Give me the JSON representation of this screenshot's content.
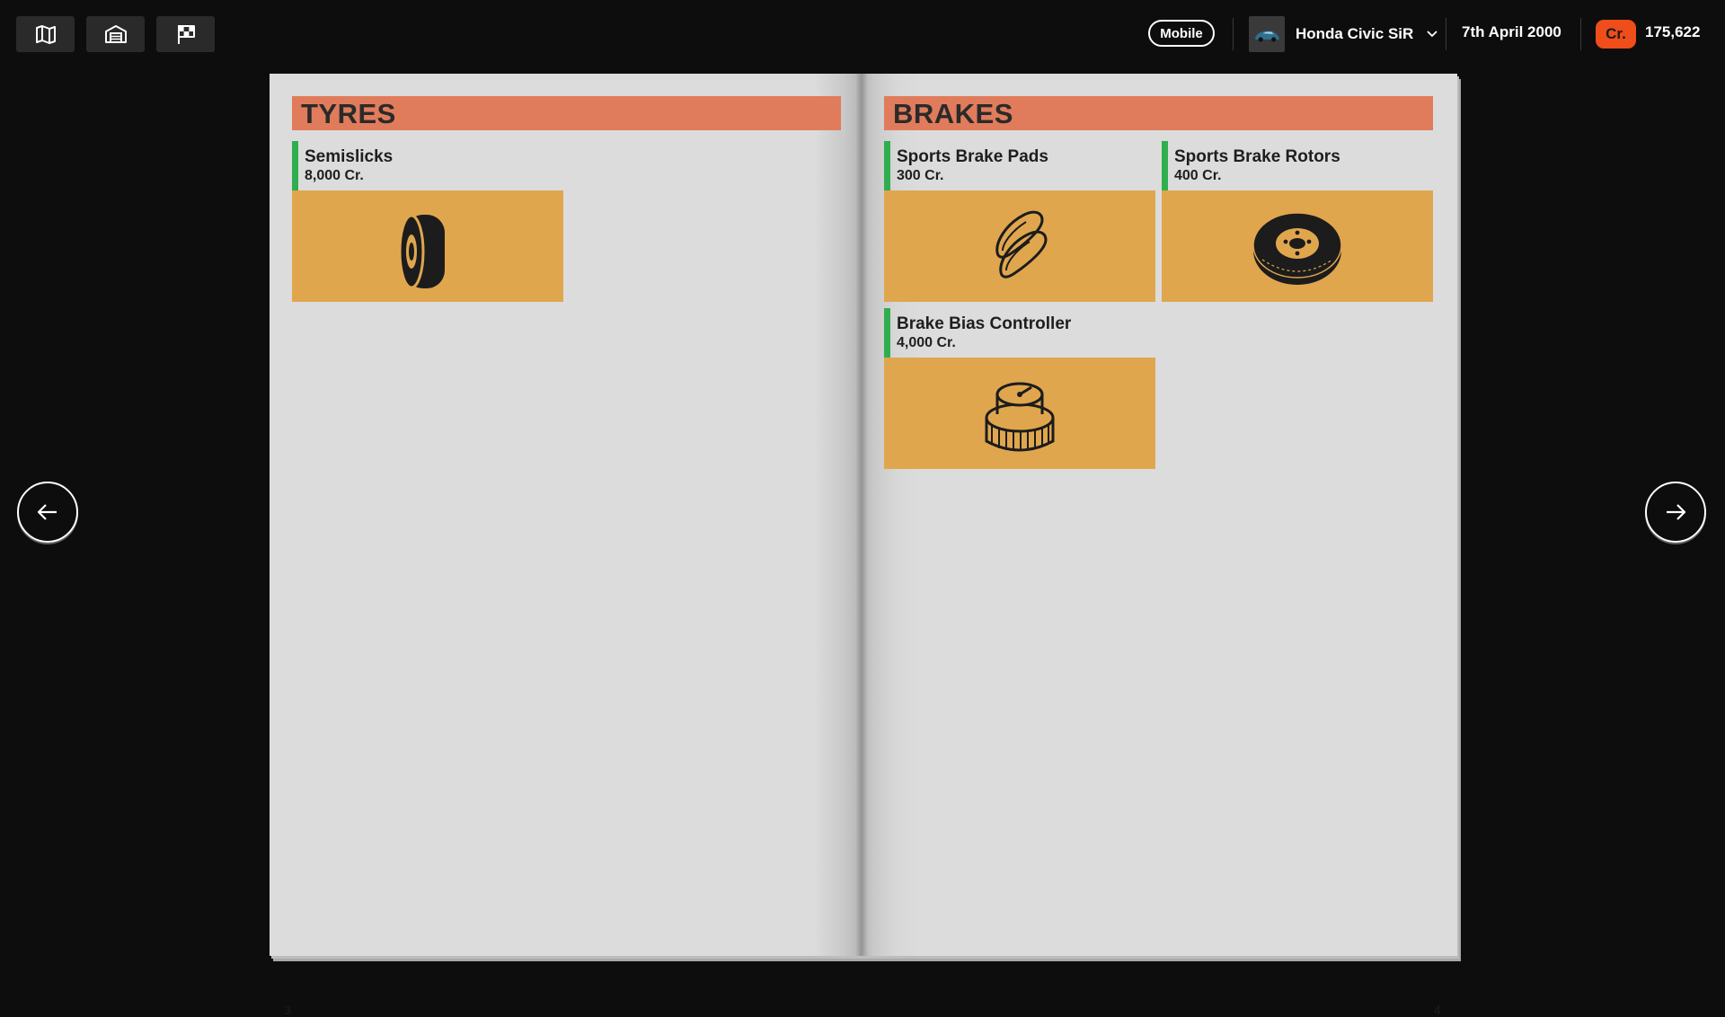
{
  "topbar": {
    "nav_icons": [
      "map-icon",
      "garage-icon",
      "flag-icon"
    ],
    "mobile_label": "Mobile",
    "car_name": "Honda Civic SiR",
    "date": "7th April 2000",
    "credits_symbol": "Cr.",
    "credits_value": "175,622"
  },
  "book": {
    "left_page": {
      "section_title": "TYRES",
      "page_number": "3",
      "items": [
        {
          "name": "Semislicks",
          "price": "8,000 Cr.",
          "icon": "tyre-icon"
        }
      ]
    },
    "right_page": {
      "section_title": "BRAKES",
      "page_number": "4",
      "items": [
        {
          "name": "Sports Brake Pads",
          "price": "300 Cr.",
          "icon": "brake-pads-icon"
        },
        {
          "name": "Sports Brake Rotors",
          "price": "400 Cr.",
          "icon": "brake-rotor-icon"
        },
        {
          "name": "Brake Bias Controller",
          "price": "4,000 Cr.",
          "icon": "brake-bias-knob-icon"
        }
      ]
    }
  },
  "colors": {
    "background": "#0d0d0d",
    "page": "#dcdcdc",
    "section_header": "#e07c5b",
    "item_tile": "#e0a64e",
    "item_accent": "#2fae4e",
    "credits_badge": "#ef4d1a"
  },
  "navigation": {
    "prev_icon": "arrow-left-icon",
    "next_icon": "arrow-right-icon"
  }
}
